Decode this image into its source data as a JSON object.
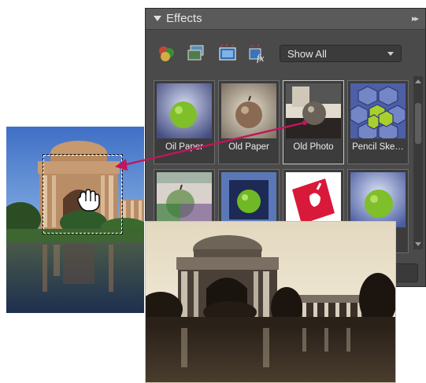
{
  "panel": {
    "title": "Effects",
    "menu_glyph": "▸▸",
    "collapse_icon": "triangle-down-icon",
    "filter_select": {
      "value": "Show All"
    },
    "toolbar_icons": [
      "layer-styles-icon",
      "photo-effects-icon",
      "filters-icon",
      "fx-all-icon"
    ],
    "thumbnails": [
      {
        "label": "Oil Paper",
        "style": "oil"
      },
      {
        "label": "Old Paper",
        "style": "old-paper"
      },
      {
        "label": "Old Photo",
        "style": "old-photo",
        "selected": true
      },
      {
        "label": "Pencil Ske…",
        "style": "pencil"
      },
      {
        "label": "",
        "style": "tinted"
      },
      {
        "label": "",
        "style": "frame"
      },
      {
        "label": "",
        "style": "red-stamp"
      },
      {
        "label": "",
        "style": "soft"
      }
    ]
  },
  "colors": {
    "panel_bg": "#4a4a4a",
    "header_bg": "#5a5a5a",
    "drag_arrow": "#c0165a",
    "sepia_light": "#e6dcc4",
    "sepia_dark": "#1a140e"
  }
}
